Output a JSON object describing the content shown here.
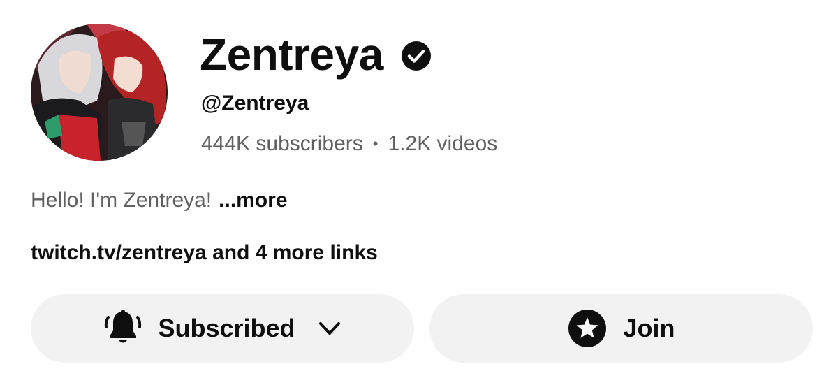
{
  "channel": {
    "name": "Zentreya",
    "handle": "@Zentreya",
    "subscribers": "444K subscribers",
    "separator": "•",
    "videos": "1.2K videos",
    "avatar_icon": "channel-avatar-art"
  },
  "description": {
    "text": "Hello! I'm Zentreya!",
    "more_label": "...more"
  },
  "links": {
    "label": "twitch.tv/zentreya and 4 more links"
  },
  "actions": {
    "subscribed_label": "Subscribed",
    "subscribed_icon": "bell-icon",
    "dropdown_icon": "chevron-down-icon",
    "join_label": "Join",
    "join_icon": "star-icon"
  },
  "colors": {
    "text_primary": "#0f0f0f",
    "text_secondary": "#606060",
    "button_bg": "#f2f2f2"
  }
}
